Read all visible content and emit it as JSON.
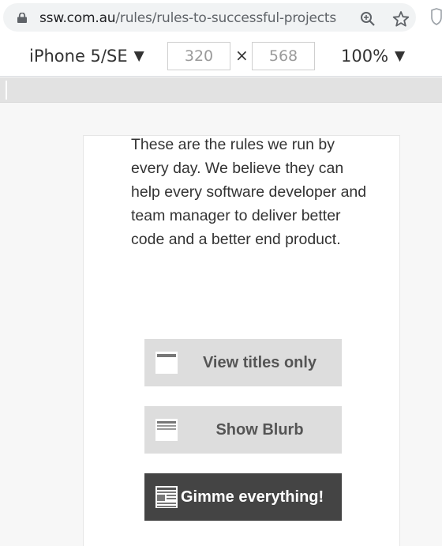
{
  "browser": {
    "url_host": "ssw.com.au",
    "url_path": "/rules/rules-to-successful-projects",
    "icons": [
      "lock-icon",
      "zoom-icon",
      "star-icon",
      "extension-icon"
    ]
  },
  "device_toolbar": {
    "device": "iPhone 5/SE",
    "width": "320",
    "times": "×",
    "height": "568",
    "zoom": "100%",
    "caret": "▼"
  },
  "page": {
    "intro": "These are the rules we run by every day. We believe they can help every software developer and team manager to deliver better code and a better end product.",
    "buttons": [
      {
        "label": "View titles only",
        "icon": "titles-icon",
        "style": "light"
      },
      {
        "label": "Show Blurb",
        "icon": "blurb-icon",
        "style": "light"
      },
      {
        "label": "Gimme everything!",
        "icon": "everything-icon",
        "style": "dark"
      }
    ]
  },
  "colors": {
    "button_light": "#dddddd",
    "button_dark": "#444444",
    "canvas": "#f7f7f7"
  }
}
